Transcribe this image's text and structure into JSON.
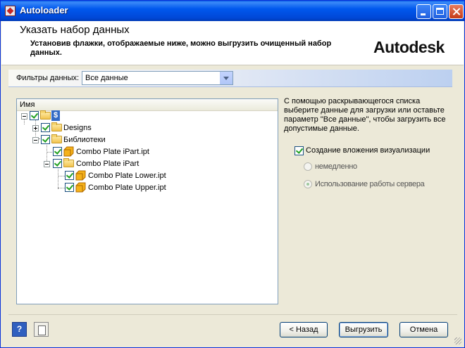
{
  "window": {
    "title": "Autoloader"
  },
  "header": {
    "title": "Указать набор данных",
    "description": "Установив флажки, отображаемые ниже, можно выгрузить очищенный набор данных.",
    "logo": "Autodesk"
  },
  "filter": {
    "label": "Фильтры данных:",
    "value": "Все данные"
  },
  "tree": {
    "column_header": "Имя",
    "nodes": [
      {
        "label": "$",
        "checked": true
      },
      {
        "label": "Designs",
        "checked": true
      },
      {
        "label": "Библиотеки",
        "checked": true
      },
      {
        "label": "Combo Plate iPart.ipt",
        "checked": true
      },
      {
        "label": "Combo Plate iPart",
        "checked": true
      },
      {
        "label": "Combo Plate Lower.ipt",
        "checked": true
      },
      {
        "label": "Combo Plate Upper.ipt",
        "checked": true
      }
    ]
  },
  "options": {
    "hint": "С помощью раскрывающегося списка выберите данные для загрузки или оставьте параметр \"Все данные\", чтобы загрузить все допустимые данные.",
    "create_attachment_label": "Создание вложения визуализации",
    "create_attachment_checked": true,
    "radio_immediately": "немедленно",
    "radio_server": "Использование работы сервера",
    "selected_radio": "radio_server"
  },
  "footer": {
    "back": "< Назад",
    "export": "Выгрузить",
    "cancel": "Отмена",
    "help_icon_text": "?"
  }
}
